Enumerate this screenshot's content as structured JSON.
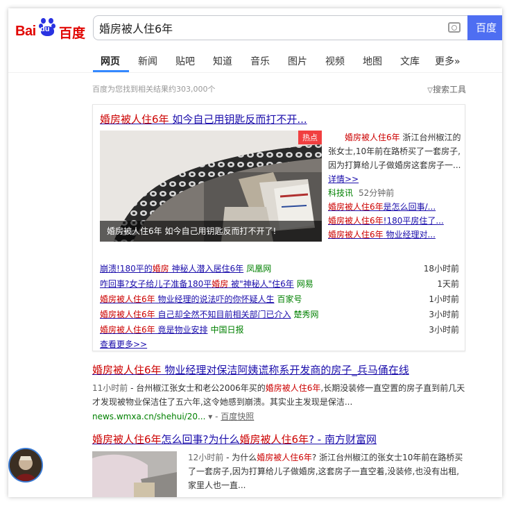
{
  "header": {
    "logo_text": "Bai",
    "logo_du": "du",
    "logo_cn": "百度",
    "search_query": "婚房被人住6年",
    "search_button": "百度"
  },
  "nav": {
    "tabs": [
      "网页",
      "新闻",
      "贴吧",
      "知道",
      "音乐",
      "图片",
      "视频",
      "地图",
      "文库",
      "更多»"
    ]
  },
  "results_info": {
    "count_text": "百度为您找到相关结果约303,000个",
    "tools_label": "搜索工具"
  },
  "news_box": {
    "title_em": "婚房被人住6年",
    "title_rest": " 如今自己用钥匙反而打不开...",
    "hot_badge": "热点",
    "image_caption": "婚房被人住6年 如今自己用钥匙反而打不开了!",
    "snippet_em": "婚房被人住6年",
    "snippet_rest": " 浙江台州椒江的张女士,10年前在路桥买了一套房子,因为打算给儿子做婚房这套房子一...",
    "detail_link": "详情>>",
    "source": "科技讯",
    "time": "52分钟前",
    "side_links": [
      {
        "em": "婚房被人住6年",
        "rest": "是怎么回事/..."
      },
      {
        "em": "婚房被人住6年",
        "rest": "!180平房住了..."
      },
      {
        "em": "婚房被人住6年",
        "rest": " 物业经理对..."
      }
    ],
    "list": [
      {
        "pre": "崩溃!180平的",
        "em": "婚房",
        "mid": " 神秘人潜入居住6年",
        "src": "凤凰网",
        "time": "18小时前"
      },
      {
        "pre": "咋回事?女子给儿子准备180平",
        "em": "婚房",
        "mid": " 被\"神秘人\"住6年",
        "src": "网易",
        "time": "1天前"
      },
      {
        "pre": "",
        "em": "婚房被人住6年",
        "mid": " 物业经理的说法吓的你怀疑人生",
        "src": "百家号",
        "time": "1小时前"
      },
      {
        "pre": "",
        "em": "婚房被人住6年",
        "mid": " 自己却全然不知目前相关部门已介入",
        "src": "楚秀网",
        "time": "3小时前"
      },
      {
        "pre": "",
        "em": "婚房被人住6年",
        "mid": " 竟是物业安排",
        "src": "中国日报",
        "time": "3小时前"
      }
    ],
    "more_link": "查看更多>>"
  },
  "results": [
    {
      "title_em": "婚房被人住6年",
      "title_rest": " 物业经理对保洁阿姨谎称系开发商的房子_兵马俑在线",
      "time": "11小时前",
      "abs_pre": " - 台州椒江张女士和老公2006年买的",
      "abs_em": "婚房被人住6年",
      "abs_rest": ",长期没装修一直空置的房子直到前几天才发现被物业保洁住了五六年,这令她感到崩溃。其实业主发现是保洁...",
      "url": "news.wmxa.cn/shehui/20...",
      "snapshot": "百度快照"
    },
    {
      "title_em1": "婚房被人住6年",
      "title_mid": "怎么回事?为什么",
      "title_em2": "婚房被人住6年",
      "title_rest": "? - 南方财富网",
      "time": "12小时前",
      "abs_pre": " - 为什么",
      "abs_em": "婚房被人住6年",
      "abs_rest": "? 浙江台州椒江的张女士10年前在路桥买了一套房子,因为打算给儿子做婚房,这套房子一直空着,没装修,也没有出租,家里人也一直..."
    }
  ]
}
